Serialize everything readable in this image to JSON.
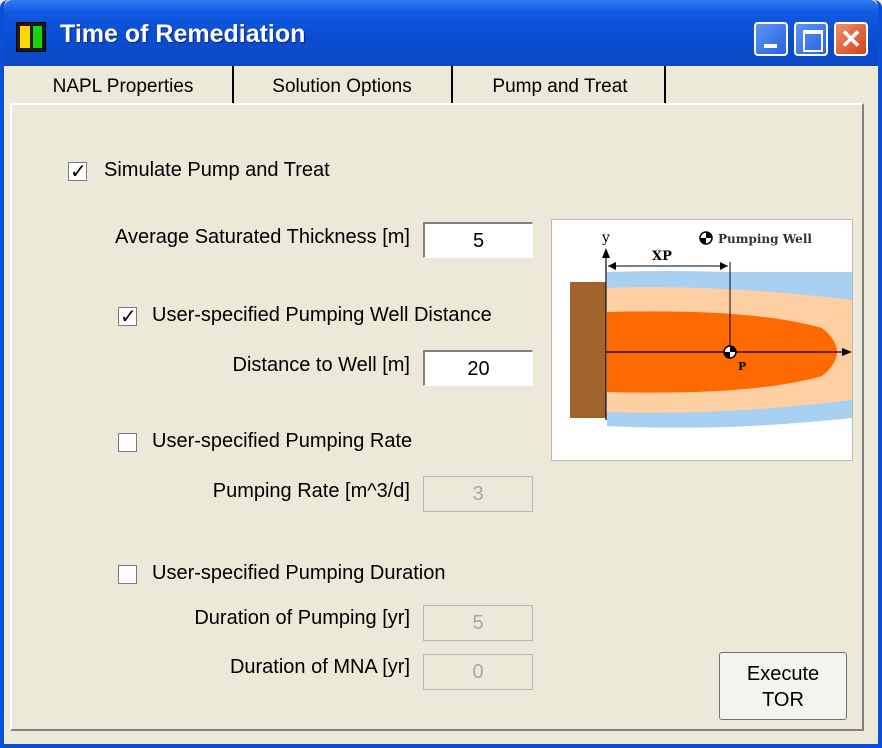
{
  "window": {
    "title": "Time of Remediation",
    "app_icon": "NAPL-icon"
  },
  "tabs": [
    {
      "label": "NAPL Properties",
      "active": false
    },
    {
      "label": "Solution Options",
      "active": false
    },
    {
      "label": "Pump and Treat",
      "active": true
    }
  ],
  "form": {
    "simulate_pump_treat": {
      "label": "Simulate Pump and Treat",
      "checked": true
    },
    "avg_sat_thickness": {
      "label": "Average Saturated Thickness [m]",
      "value": "5"
    },
    "user_pump_well_distance": {
      "label": "User-specified Pumping Well Distance",
      "checked": true
    },
    "distance_to_well": {
      "label": "Distance to Well [m]",
      "value": "20"
    },
    "user_pump_rate": {
      "label": "User-specified Pumping Rate",
      "checked": false
    },
    "pumping_rate": {
      "label": "Pumping Rate [m^3/d]",
      "value": "3",
      "disabled": true
    },
    "user_pump_duration": {
      "label": "User-specified Pumping Duration",
      "checked": false
    },
    "duration_pumping": {
      "label": "Duration of Pumping [yr]",
      "value": "5",
      "disabled": true
    },
    "duration_mna": {
      "label": "Duration of MNA [yr]",
      "value": "0",
      "disabled": true
    }
  },
  "diagram": {
    "legend": "Pumping Well",
    "y_label": "y",
    "xp_label": "XP",
    "p_label": "P"
  },
  "execute_button": {
    "line1": "Execute",
    "line2": "TOR"
  },
  "colors": {
    "plume_core": "#FF6A00",
    "plume_mid": "#FFCFA4",
    "plume_outer": "#A8D0F0",
    "source": "#A0642C",
    "title_bar": "#0A4ED3"
  }
}
